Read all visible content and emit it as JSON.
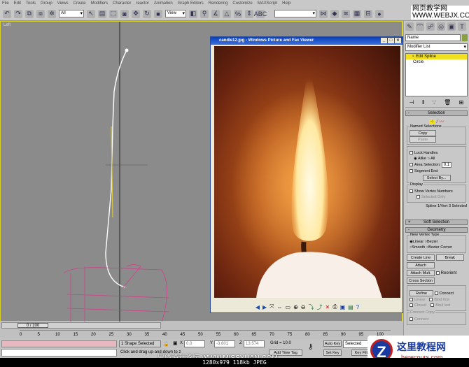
{
  "menu": [
    "File",
    "Edit",
    "Tools",
    "Group",
    "Views",
    "Create",
    "Modifiers",
    "Character",
    "reactor",
    "Animation",
    "Graph Editors",
    "Rendering",
    "Customize",
    "MAXScript",
    "Help"
  ],
  "toolbar": {
    "selection_filter": "All",
    "coord_system": "View"
  },
  "viewport": {
    "label": "Left",
    "frame_border_color": "#d8d028",
    "spline_color": "#ffffff",
    "mesh_color": "#d0408a"
  },
  "viewer": {
    "title": "candle12.jpg - Windows Picture and Fax Viewer",
    "buttons": [
      "minimize",
      "maximize",
      "close"
    ],
    "tools": [
      "previous-icon",
      "next-icon",
      "best-fit-icon",
      "actual-size-icon",
      "slideshow-icon",
      "zoom-in-icon",
      "zoom-out-icon",
      "rotate-cw-icon",
      "rotate-ccw-icon",
      "delete-icon",
      "print-icon",
      "save-icon",
      "edit-icon",
      "help-icon"
    ]
  },
  "panel": {
    "name_placeholder": "Name",
    "modifier_list": "Modifier List",
    "stack": [
      "Edit Spline",
      "Circle"
    ],
    "selection": {
      "title": "Selection",
      "named": "Named Selections",
      "copy": "Copy",
      "paste": "Paste",
      "lock_handles": "Lock Handles",
      "alike": "Alike",
      "all": "All",
      "area_selection": "Area Selection:",
      "area_value": "0.1",
      "segment_end": "Segment End",
      "select_by": "Select By...",
      "display": "Display",
      "show_vertex_numbers": "Show Vertex Numbers",
      "selected_only": "Selected Only",
      "status": "Spline 1/Vert 3 Selected"
    },
    "soft_selection": "Soft Selection",
    "geometry": {
      "title": "Geometry",
      "new_vertex_type": "New Vertex Type",
      "linear": "Linear",
      "bezier": "Bezier",
      "smooth": "Smooth",
      "bezier_corner": "Bezier Corner",
      "create_line": "Create Line",
      "break": "Break",
      "attach": "Attach",
      "attach_mult": "Attach Mult.",
      "reorient": "Reorient",
      "cross_section": "Cross Section",
      "refine": "Refine",
      "connect": "Connect",
      "linear2": "Linear",
      "closed": "Closed",
      "bind_first": "Bind first",
      "bind_last": "Bind last",
      "connect_copy": "Connect Copy",
      "connect2": "Connect"
    }
  },
  "timeline": {
    "frame": "0 / 100",
    "ticks": [
      "0",
      "5",
      "10",
      "15",
      "20",
      "25",
      "30",
      "35",
      "40",
      "45",
      "50",
      "55",
      "60",
      "65",
      "70",
      "75",
      "80",
      "85",
      "90",
      "95",
      "100"
    ]
  },
  "status": {
    "selected": "1 Shape Selected",
    "prompt": "Click and drag up-and-down to z",
    "x": "0.0",
    "y": "-3.601",
    "z": "13.574",
    "grid": "Grid = 10.0",
    "add_time_tag": "Add Time Tag",
    "auto_key": "Auto Key",
    "set_key": "Set Key",
    "key_mode": "Selected",
    "key_filters": "Key Filters..."
  },
  "watermarks": {
    "top": "网页教学网 WWW.WEBJX.COM",
    "bottom": "思缘设计论坛 WWW.MISSYUAN.COM",
    "corner": "这里教程网 herecours.com"
  },
  "caption": "1280x979  118kb  JPEG"
}
